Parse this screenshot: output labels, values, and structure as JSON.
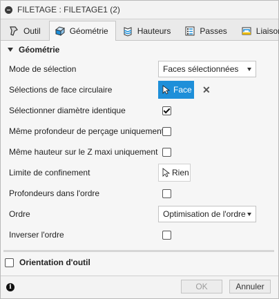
{
  "window": {
    "title": "FILETAGE : FILETAGE1 (2)"
  },
  "tabs": [
    {
      "label": "Outil",
      "icon": "tool-icon",
      "active": false
    },
    {
      "label": "Géométrie",
      "icon": "geometry-icon",
      "active": true
    },
    {
      "label": "Hauteurs",
      "icon": "heights-icon",
      "active": false
    },
    {
      "label": "Passes",
      "icon": "passes-icon",
      "active": false
    },
    {
      "label": "Liaison",
      "icon": "linking-icon",
      "active": false
    }
  ],
  "geometry": {
    "section_title": "Géométrie",
    "selection_mode": {
      "label": "Mode de sélection",
      "value": "Faces sélectionnées"
    },
    "circular_face": {
      "label": "Sélections de face circulaire",
      "button_label": "Face"
    },
    "same_diameter": {
      "label": "Sélectionner diamètre identique",
      "checked": true
    },
    "same_hole_depth": {
      "label": "Même profondeur de perçage uniquement",
      "checked": false
    },
    "same_z_top": {
      "label": "Même hauteur sur le Z maxi uniquement",
      "checked": false
    },
    "containment": {
      "label": "Limite de confinement",
      "button_label": "Rien"
    },
    "depth_order": {
      "label": "Profondeurs dans l'ordre",
      "checked": false
    },
    "order": {
      "label": "Ordre",
      "value": "Optimisation de l'ordre"
    },
    "reverse_order": {
      "label": "Inverser l'ordre",
      "checked": false
    }
  },
  "tool_orientation": {
    "label": "Orientation d'outil",
    "checked": false
  },
  "footer": {
    "ok_label": "OK",
    "cancel_label": "Annuler",
    "info_glyph": "i"
  },
  "colors": {
    "accent": "#1e8fd9",
    "panel_bg": "#f6f6f6"
  }
}
